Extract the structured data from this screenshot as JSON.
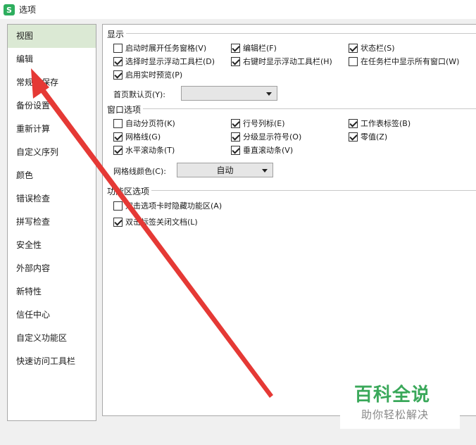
{
  "window": {
    "title": "选项",
    "icon_letter": "S"
  },
  "sidebar": {
    "items": [
      {
        "label": "视图",
        "selected": true
      },
      {
        "label": "编辑"
      },
      {
        "label": "常规与保存"
      },
      {
        "label": "备份设置"
      },
      {
        "label": "重新计算"
      },
      {
        "label": "自定义序列"
      },
      {
        "label": "颜色"
      },
      {
        "label": "错误检查"
      },
      {
        "label": "拼写检查"
      },
      {
        "label": "安全性"
      },
      {
        "label": "外部内容"
      },
      {
        "label": "新特性"
      },
      {
        "label": "信任中心"
      },
      {
        "label": "自定义功能区"
      },
      {
        "label": "快速访问工具栏"
      }
    ]
  },
  "display": {
    "title": "显示",
    "options": [
      {
        "label": "启动时展开任务窗格(V)",
        "checked": false
      },
      {
        "label": "编辑栏(F)",
        "checked": true
      },
      {
        "label": "状态栏(S)",
        "checked": true
      },
      {
        "label": "选择时显示浮动工具栏(D)",
        "checked": true
      },
      {
        "label": "右键时显示浮动工具栏(H)",
        "checked": true
      },
      {
        "label": "在任务栏中显示所有窗口(W)",
        "checked": false
      },
      {
        "label": "启用实时预览(P)",
        "checked": true
      }
    ],
    "home_label": "首页默认页(Y):",
    "home_value": ""
  },
  "window_options": {
    "title": "窗口选项",
    "options": [
      {
        "label": "自动分页符(K)",
        "checked": false
      },
      {
        "label": "行号列标(E)",
        "checked": true
      },
      {
        "label": "工作表标签(B)",
        "checked": true
      },
      {
        "label": "网格线(G)",
        "checked": true
      },
      {
        "label": "分级显示符号(O)",
        "checked": true
      },
      {
        "label": "零值(Z)",
        "checked": true
      },
      {
        "label": "水平滚动条(T)",
        "checked": true
      },
      {
        "label": "垂直滚动条(V)",
        "checked": true
      }
    ],
    "grid_color_label": "网格线颜色(C):",
    "grid_color_value": "自动"
  },
  "ribbon": {
    "title": "功能区选项",
    "options": [
      {
        "label": "双击选项卡时隐藏功能区(A)",
        "checked": false
      },
      {
        "label": "双击标签关闭文档(L)",
        "checked": true
      }
    ]
  },
  "watermark": {
    "main": "百科全说",
    "sub": "助你轻松解决"
  },
  "colors": {
    "accent_green": "#2eae5e",
    "arrow_red": "#e53935",
    "selected_bg": "#dbe9d4"
  }
}
